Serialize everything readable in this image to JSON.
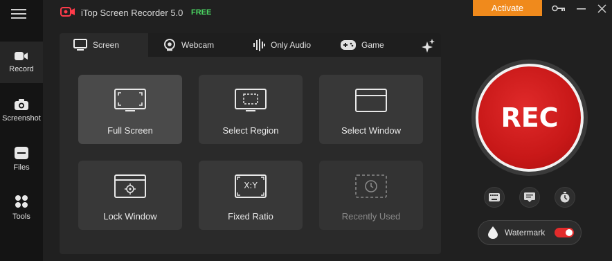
{
  "app": {
    "title": "iTop Screen Recorder 5.0",
    "free_label": "FREE",
    "activate_label": "Activate"
  },
  "sidebar": {
    "items": [
      {
        "label": "Record",
        "icon": "video-camera-icon"
      },
      {
        "label": "Screenshot",
        "icon": "camera-icon"
      },
      {
        "label": "Files",
        "icon": "folder-icon"
      },
      {
        "label": "Tools",
        "icon": "grid-icon"
      }
    ]
  },
  "tabs": [
    {
      "label": "Screen",
      "icon": "monitor-icon"
    },
    {
      "label": "Webcam",
      "icon": "webcam-icon"
    },
    {
      "label": "Only Audio",
      "icon": "audio-wave-icon"
    },
    {
      "label": "Game",
      "icon": "gamepad-icon"
    }
  ],
  "modes": [
    {
      "label": "Full Screen",
      "icon": "full-screen-icon"
    },
    {
      "label": "Select Region",
      "icon": "select-region-icon"
    },
    {
      "label": "Select Window",
      "icon": "select-window-icon"
    },
    {
      "label": "Lock Window",
      "icon": "lock-window-icon"
    },
    {
      "label": "Fixed Ratio",
      "icon": "fixed-ratio-icon",
      "badge": "X:Y"
    },
    {
      "label": "Recently Used",
      "icon": "history-icon"
    }
  ],
  "record": {
    "label": "REC"
  },
  "watermark": {
    "label": "Watermark",
    "enabled": true
  },
  "colors": {
    "accent_orange": "#f08a1c",
    "rec_red": "#c81818",
    "free_green": "#4cd964"
  }
}
